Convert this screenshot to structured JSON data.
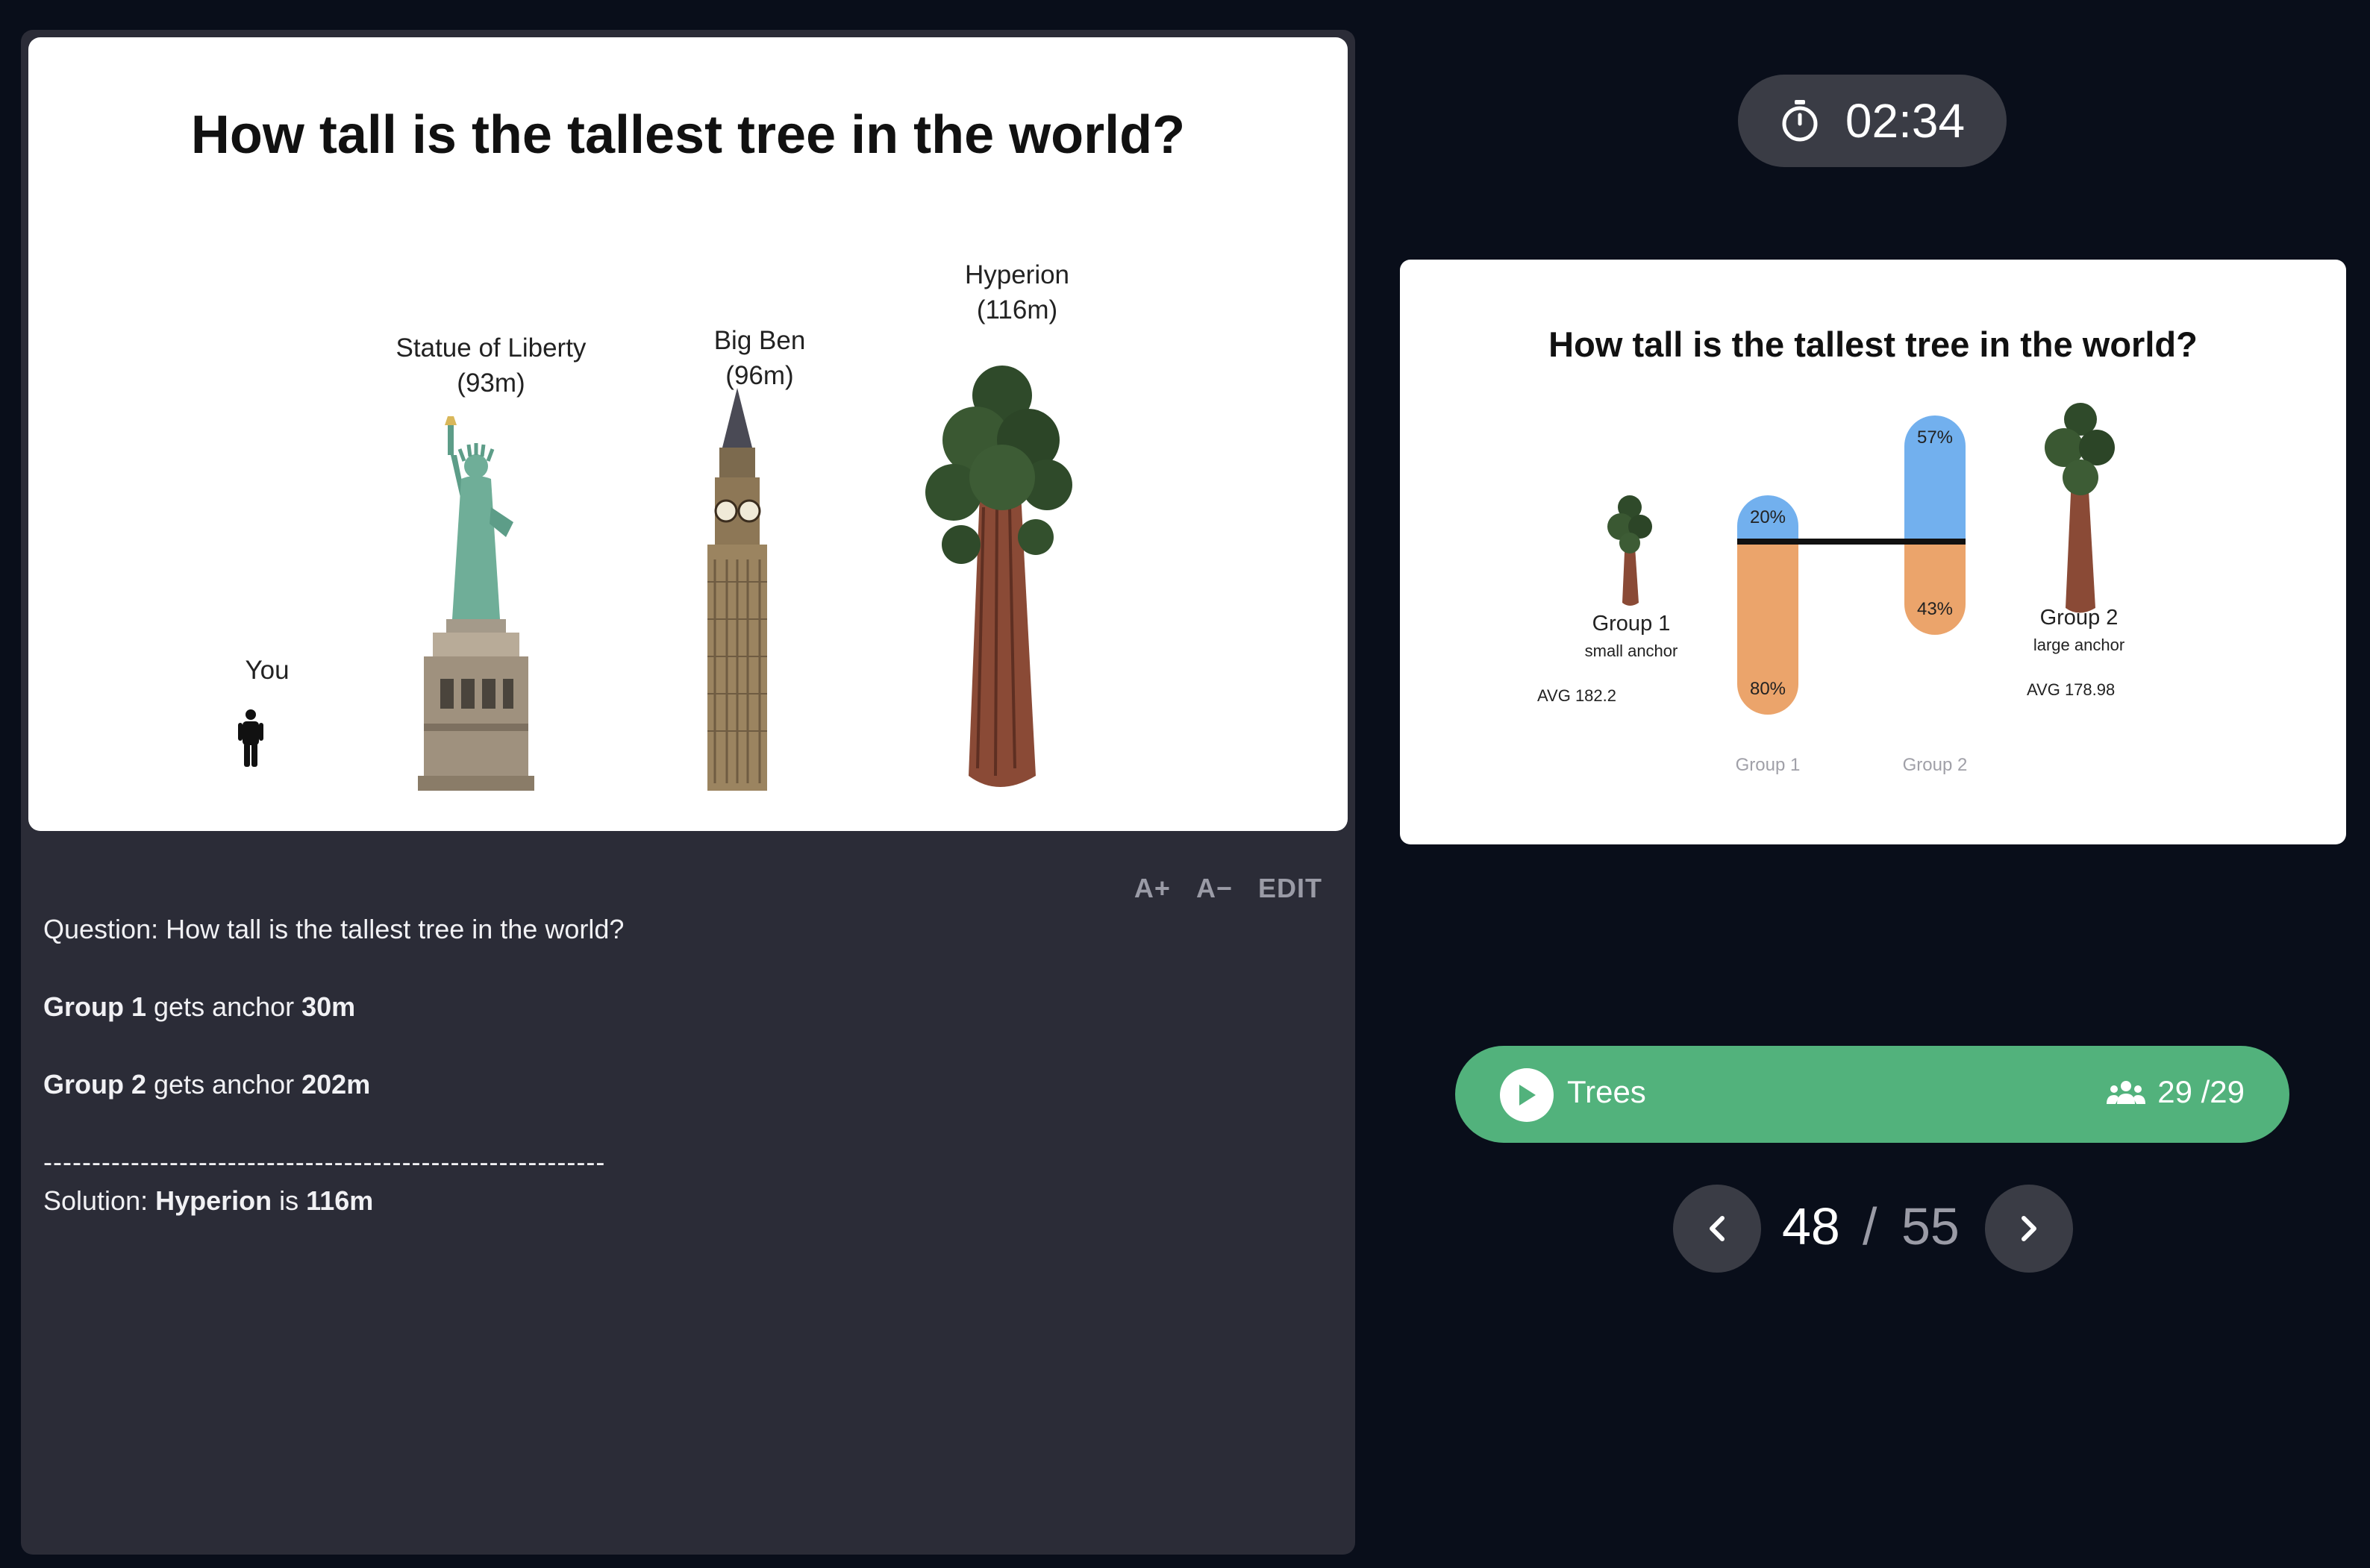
{
  "slide": {
    "title": "How tall is the tallest tree in the world?",
    "figures": [
      {
        "label": "You"
      },
      {
        "label": "Statue of Liberty\n(93m)"
      },
      {
        "label": "Big Ben\n(96m)"
      },
      {
        "label": "Hyperion\n(116m)"
      }
    ]
  },
  "toolbar": {
    "increase_font": "A+",
    "decrease_font": "A−",
    "edit": "EDIT"
  },
  "notes": {
    "question_prefix": "Question:",
    "question_text": " How tall is the tallest tree in the world?",
    "group1_name": "Group 1",
    "group1_mid": " gets anchor ",
    "group1_anchor": "30m",
    "group2_name": "Group 2",
    "group2_mid": " gets anchor ",
    "group2_anchor": "202m",
    "divider": "----------------------------------------------------------",
    "solution_prefix": "Solution: ",
    "solution_name": "Hyperion",
    "solution_mid": " is ",
    "solution_value": "116m"
  },
  "timer": {
    "icon": "stopwatch-icon",
    "value": "02:34"
  },
  "results": {
    "title": "How tall is the tallest tree in the world?",
    "group1": {
      "name": "Group 1",
      "sub": "small anchor",
      "avg": "AVG 182.2",
      "axis_label": "Group 1"
    },
    "group2": {
      "name": "Group 2",
      "sub": "large anchor",
      "avg": "AVG 178.98",
      "axis_label": "Group 2"
    },
    "chart_data": {
      "type": "bar",
      "categories": [
        "Group 1",
        "Group 2"
      ],
      "series": [
        {
          "values": [
            20,
            57
          ],
          "labels": [
            "20%",
            "57%"
          ],
          "color": "#72b0ee"
        },
        {
          "values": [
            80,
            43
          ],
          "labels": [
            "80%",
            "43%"
          ],
          "color": "#eba46b"
        }
      ]
    }
  },
  "session": {
    "icon": "play-icon",
    "name": "Trees",
    "participants_icon": "users-icon",
    "count": "29 /29",
    "color": "#52b27c"
  },
  "pager": {
    "current": "48",
    "separator": "/",
    "total": "55"
  }
}
